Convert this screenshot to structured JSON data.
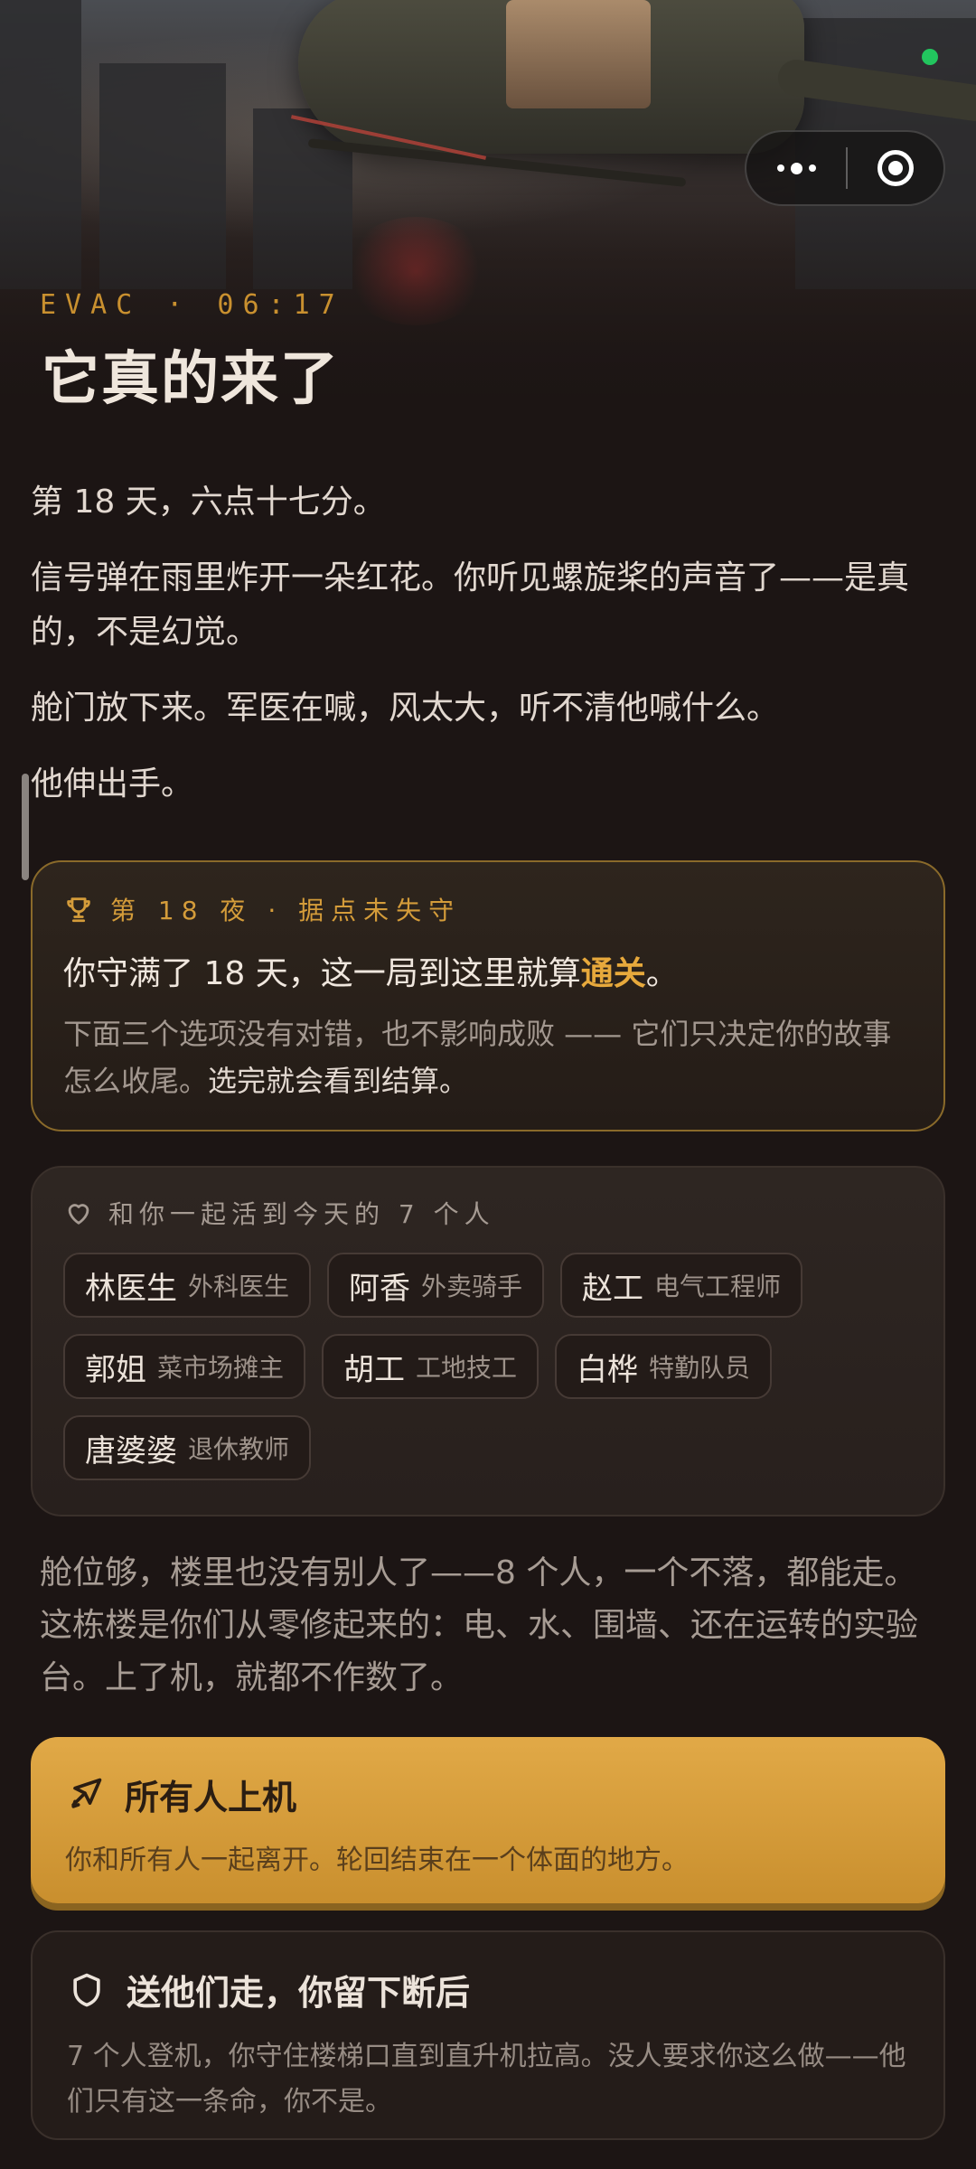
{
  "header": {
    "tag": "EVAC · 06:17",
    "title": "它真的来了"
  },
  "story": [
    "第 18 天，六点十七分。",
    "信号弹在雨里炸开一朵红花。你听见螺旋桨的声音了——是真的，不是幻觉。",
    "舱门放下来。军医在喊，风太大，听不清他喊什么。",
    "他伸出手。"
  ],
  "win": {
    "head": "第 18 夜 · 据点未失守",
    "main_pre": "你守满了 18 天，这一局到这里就算",
    "main_hl": "通关",
    "main_post": "。",
    "sub_pre": "下面三个选项没有对错，也不影响成败 —— 它们只决定你的故事怎么收尾。",
    "sub_em": "选完就会看到结算。"
  },
  "group": {
    "head": "和你一起活到今天的 7 个人",
    "members": [
      {
        "name": "林医生",
        "role": "外科医生"
      },
      {
        "name": "阿香",
        "role": "外卖骑手"
      },
      {
        "name": "赵工",
        "role": "电气工程师"
      },
      {
        "name": "郭姐",
        "role": "菜市场摊主"
      },
      {
        "name": "胡工",
        "role": "工地技工"
      },
      {
        "name": "白桦",
        "role": "特勤队员"
      },
      {
        "name": "唐婆婆",
        "role": "退休教师"
      }
    ]
  },
  "narration": "舱位够，楼里也没有别人了——8 个人，一个不落，都能走。这栋楼是你们从零修起来的：电、水、围墙、还在运转的实验台。上了机，就都不作数了。",
  "choices": [
    {
      "title": "所有人上机",
      "desc": "你和所有人一起离开。轮回结束在一个体面的地方。",
      "icon": "plane-icon"
    },
    {
      "title": "送他们走，你留下断后",
      "desc": "7 个人登机，你守住楼梯口直到直升机拉高。没人要求你这么做——他们只有这一条命，你不是。",
      "icon": "shield-icon"
    }
  ],
  "colors": {
    "accent": "#e1a947",
    "status_dot": "#22c55e",
    "background": "#1c1514"
  }
}
